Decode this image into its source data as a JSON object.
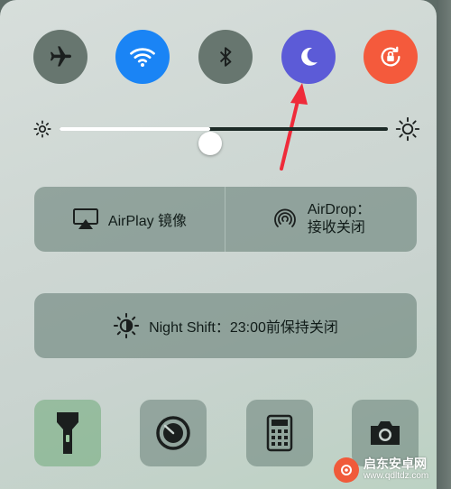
{
  "control_center": {
    "toggles": [
      {
        "name": "airplane-mode",
        "icon": "airplane-icon",
        "active": false
      },
      {
        "name": "wifi",
        "icon": "wifi-icon",
        "active": true
      },
      {
        "name": "bluetooth",
        "icon": "bluetooth-icon",
        "active": false
      },
      {
        "name": "do-not-disturb",
        "icon": "moon-icon",
        "active": true
      },
      {
        "name": "rotation-lock",
        "icon": "rotation-lock-icon",
        "active": true
      }
    ],
    "brightness": {
      "level": 0.46
    },
    "airplay": {
      "label": "AirPlay 镜像"
    },
    "airdrop": {
      "line1": "AirDrop：",
      "line2": "接收关闭"
    },
    "nightshift": {
      "label": "Night Shift：23:00前保持关闭"
    },
    "apps": [
      {
        "name": "flashlight",
        "icon": "flashlight-icon"
      },
      {
        "name": "timer",
        "icon": "timer-icon"
      },
      {
        "name": "calculator",
        "icon": "calculator-icon"
      },
      {
        "name": "camera",
        "icon": "camera-icon"
      }
    ]
  },
  "watermark": {
    "title": "启东安卓网",
    "url": "www.qdltdz.com"
  },
  "colors": {
    "wifi_active": "#1a84f5",
    "dnd_active": "#5c5bd7",
    "rotation_active": "#f45a3c",
    "inactive": "#67766f",
    "annotation_arrow": "#ef2b3a"
  }
}
